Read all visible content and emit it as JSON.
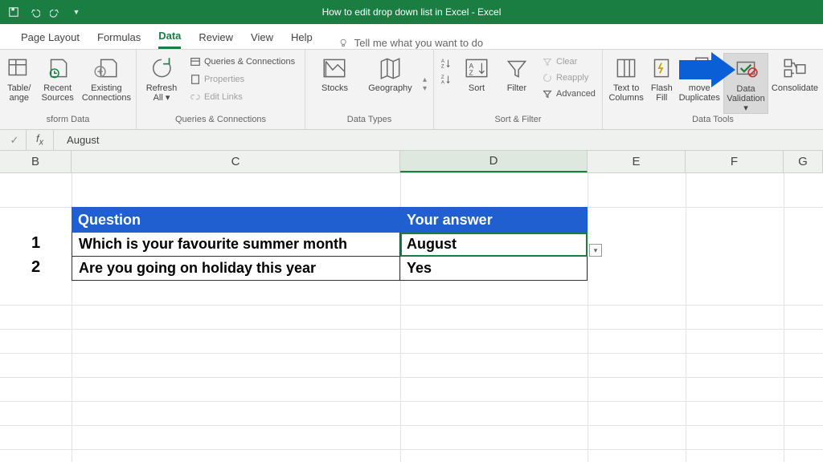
{
  "titlebar": {
    "title": "How to edit drop down list in Excel  -  Excel"
  },
  "tabs": {
    "items": [
      "Page Layout",
      "Formulas",
      "Data",
      "Review",
      "View",
      "Help"
    ],
    "active": "Data",
    "tell_me": "Tell me what you want to do"
  },
  "ribbon": {
    "transform": {
      "label": "sform Data",
      "from_table": "Table/\nange",
      "recent": "Recent\nSources",
      "existing": "Existing\nConnections"
    },
    "queries": {
      "label": "Queries & Connections",
      "refresh": "Refresh\nAll ▾",
      "qc": "Queries & Connections",
      "props": "Properties",
      "edit_links": "Edit Links"
    },
    "datatypes": {
      "label": "Data Types",
      "stocks": "Stocks",
      "geography": "Geography"
    },
    "sortfilter": {
      "label": "Sort & Filter",
      "sort": "Sort",
      "filter": "Filter",
      "clear": "Clear",
      "reapply": "Reapply",
      "advanced": "Advanced"
    },
    "datatools": {
      "label": "Data Tools",
      "text_to_columns": "Text to\nColumns",
      "flash_fill": "Flash\nFill",
      "remove_dup": "move\nDuplicates",
      "validation": "Data\nValidation ▾",
      "consolidate": "Consolidate"
    }
  },
  "formula_bar": {
    "value": "August"
  },
  "columns": [
    "B",
    "C",
    "D",
    "E",
    "F",
    "G"
  ],
  "table": {
    "header": {
      "q": "Question",
      "a": "Your answer"
    },
    "rows": [
      {
        "n": "1",
        "q": "Which is your favourite summer month",
        "a": "August"
      },
      {
        "n": "2",
        "q": "Are you going on holiday this year",
        "a": "Yes"
      }
    ]
  },
  "selected_cell": "D4"
}
